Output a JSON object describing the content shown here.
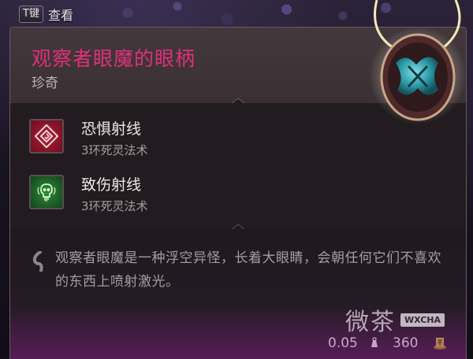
{
  "hint": {
    "key": "T键",
    "label": "查看"
  },
  "item": {
    "name": "观察者眼魔的眼柄",
    "rarity": "珍奇",
    "name_color": "#e0307a"
  },
  "spells": [
    {
      "name": "恐惧射线",
      "subtitle": "3环死灵法术",
      "icon": "spiral-icon",
      "color": "#c0203a"
    },
    {
      "name": "致伤射线",
      "subtitle": "3环死灵法术",
      "icon": "skull-icon",
      "color": "#2f9a3a"
    }
  ],
  "description": "观察者眼魔是一种浮空异怪，长着大眼睛，会朝任何它们不喜欢的东西上喷射激光。",
  "footer": {
    "weight": "0.05",
    "value": "360"
  },
  "watermark": {
    "text": "微茶",
    "badge": "WXCHA"
  }
}
